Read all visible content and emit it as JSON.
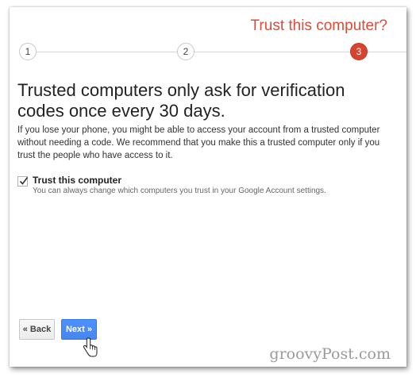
{
  "header": {
    "step_title": "Trust this computer?"
  },
  "steps": [
    {
      "label": "1",
      "active": false
    },
    {
      "label": "2",
      "active": false
    },
    {
      "label": "3",
      "active": true
    }
  ],
  "content": {
    "headline": "Trusted computers only ask for verification codes once every 30 days.",
    "body": "If you lose your phone, you might be able to access your account from a trusted computer without needing a code. We recommend that you make this a trusted computer only if you trust the people who have access to it."
  },
  "trust_option": {
    "checked": true,
    "label": "Trust this computer",
    "help": "You can always change which computers you trust in your Google Account settings."
  },
  "buttons": {
    "back_label": "« Back",
    "next_label": "Next »"
  },
  "watermark": "groovyPost.com",
  "colors": {
    "accent_red": "#dd4b39",
    "active_step": "#d64430",
    "primary_blue": "#4d90fe"
  }
}
